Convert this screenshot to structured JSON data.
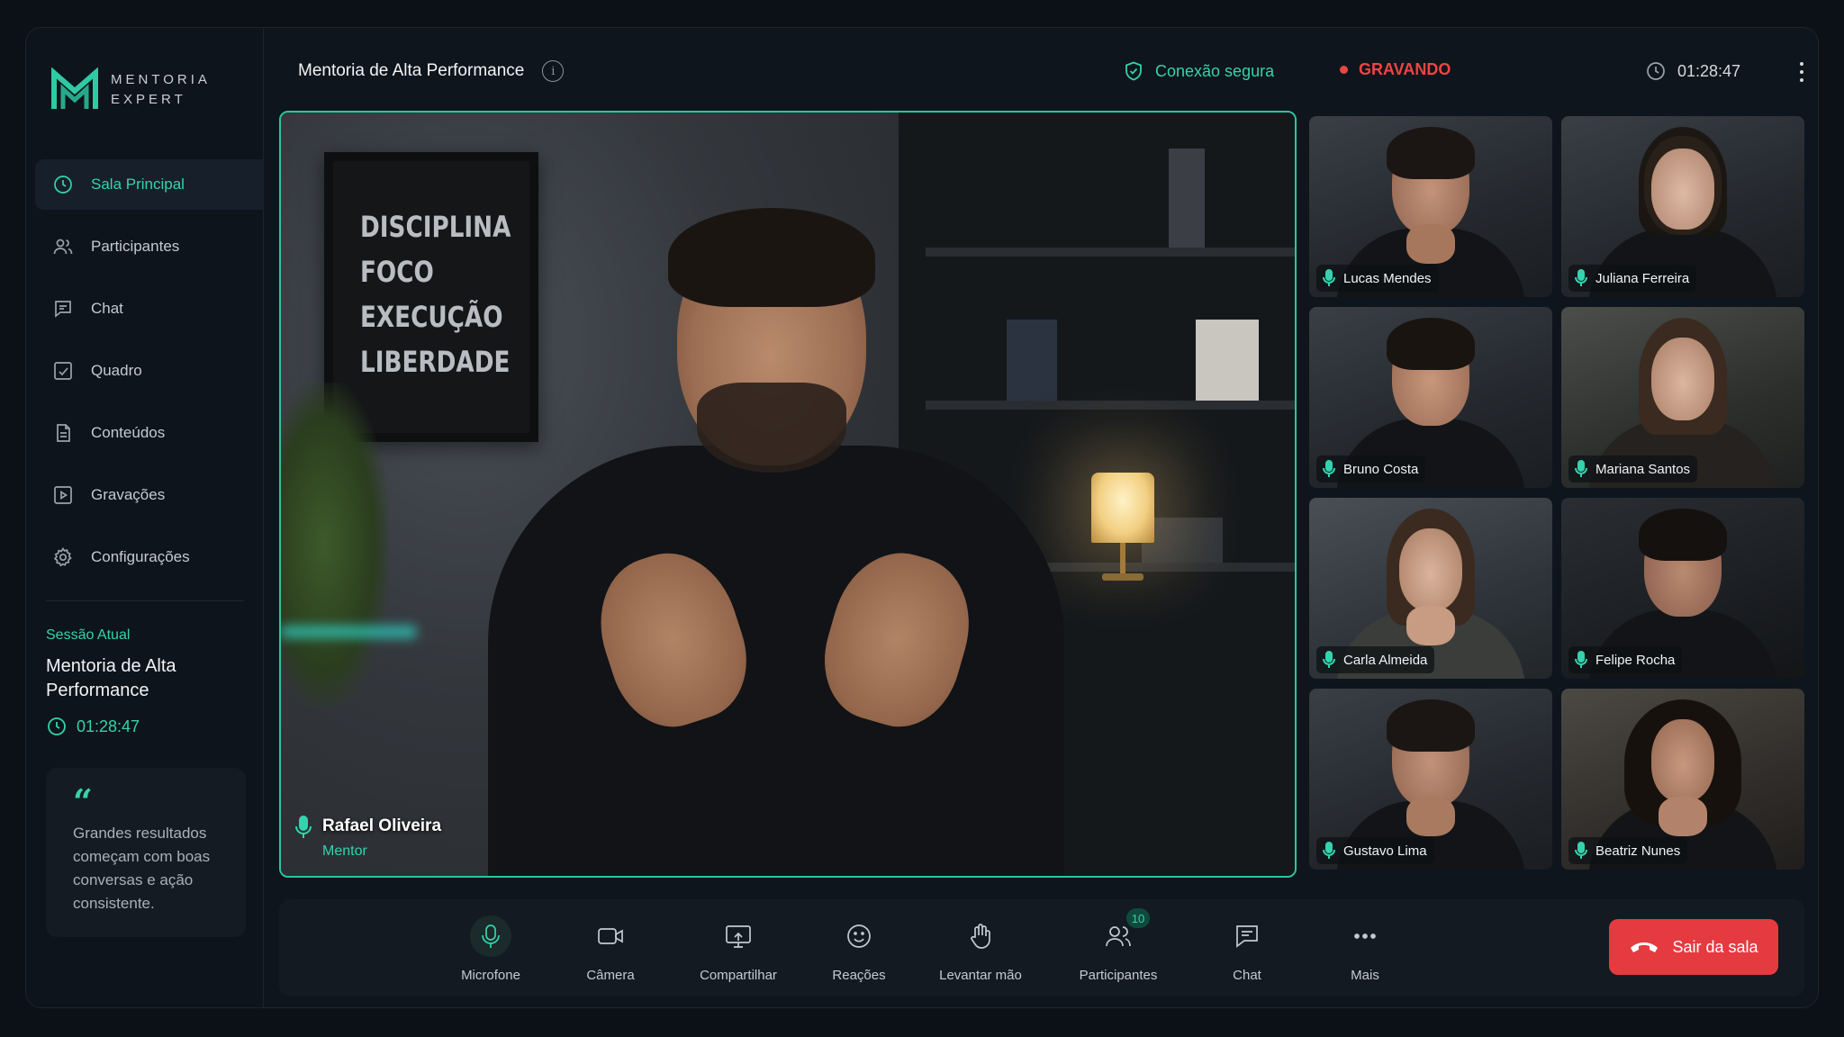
{
  "brand": {
    "line1": "MENTORIA",
    "line2": "EXPERT"
  },
  "sidebar": {
    "items": [
      {
        "label": "Sala Principal",
        "icon": "clock-icon",
        "active": true
      },
      {
        "label": "Participantes",
        "icon": "users-icon"
      },
      {
        "label": "Chat",
        "icon": "chat-icon"
      },
      {
        "label": "Quadro",
        "icon": "whiteboard-icon"
      },
      {
        "label": "Conteúdos",
        "icon": "document-icon"
      },
      {
        "label": "Gravações",
        "icon": "recording-icon"
      },
      {
        "label": "Configurações",
        "icon": "gear-icon"
      }
    ],
    "session": {
      "label": "Sessão Atual",
      "title": "Mentoria de Alta Performance",
      "time": "01:28:47"
    },
    "quote": {
      "mark": "“",
      "text": "Grandes resultados começam com boas conversas e ação consistente."
    }
  },
  "header": {
    "title": "Mentoria de Alta Performance",
    "secure": "Conexão segura",
    "recording": "GRAVANDO",
    "timer": "01:28:47"
  },
  "main_video": {
    "name": "Rafael Oliveira",
    "role": "Mentor",
    "poster": [
      "DISCIPLINA",
      "FOCO",
      "EXECUÇÃO",
      "LIBERDADE"
    ]
  },
  "participants": [
    {
      "name": "Lucas Mendes"
    },
    {
      "name": "Juliana Ferreira"
    },
    {
      "name": "Bruno Costa"
    },
    {
      "name": "Mariana Santos"
    },
    {
      "name": "Carla Almeida"
    },
    {
      "name": "Felipe Rocha"
    },
    {
      "name": "Gustavo Lima"
    },
    {
      "name": "Beatriz Nunes"
    }
  ],
  "toolbar": {
    "mic": "Microfone",
    "camera": "Câmera",
    "share": "Compartilhar",
    "reactions": "Reações",
    "raise_hand": "Levantar mão",
    "participants": "Participantes",
    "participants_count": "10",
    "chat": "Chat",
    "more": "Mais",
    "leave": "Sair da sala"
  },
  "colors": {
    "accent": "#34d3ad",
    "danger": "#e53a40",
    "bg": "#0f151c"
  }
}
